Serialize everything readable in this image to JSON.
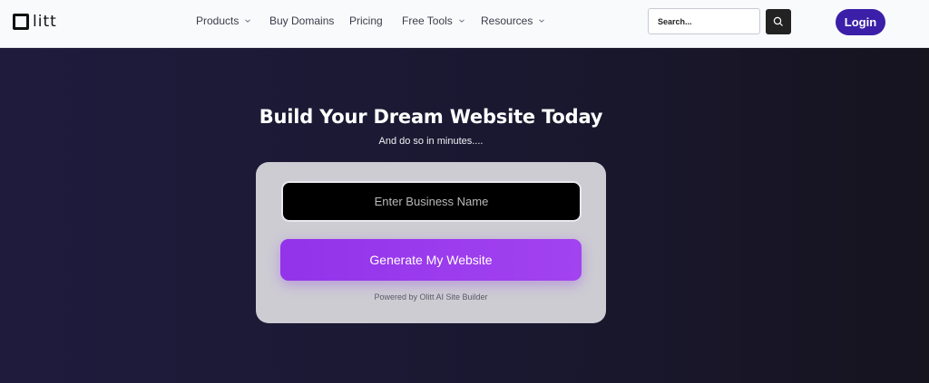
{
  "header": {
    "logo_text": "litt",
    "nav": [
      {
        "label": "Products",
        "has_dropdown": true
      },
      {
        "label": "Buy Domains",
        "has_dropdown": false
      },
      {
        "label": "Pricing",
        "has_dropdown": false
      },
      {
        "label": "Free Tools",
        "has_dropdown": true
      },
      {
        "label": "Resources",
        "has_dropdown": true
      }
    ],
    "search": {
      "placeholder": "Search...",
      "value": ""
    },
    "login_label": "Login"
  },
  "hero": {
    "title": "Build Your Dream Website Today",
    "subtitle": "And do so in minutes....",
    "business_input": {
      "placeholder": "Enter Business Name",
      "value": ""
    },
    "generate_label": "Generate My Website",
    "powered_by": "Powered by Olitt AI Site Builder"
  },
  "colors": {
    "login_bg": "#3b1fa8",
    "generate_bg": "#9333ea",
    "hero_bg": "#1b1930",
    "card_bg": "#cdccd3"
  }
}
